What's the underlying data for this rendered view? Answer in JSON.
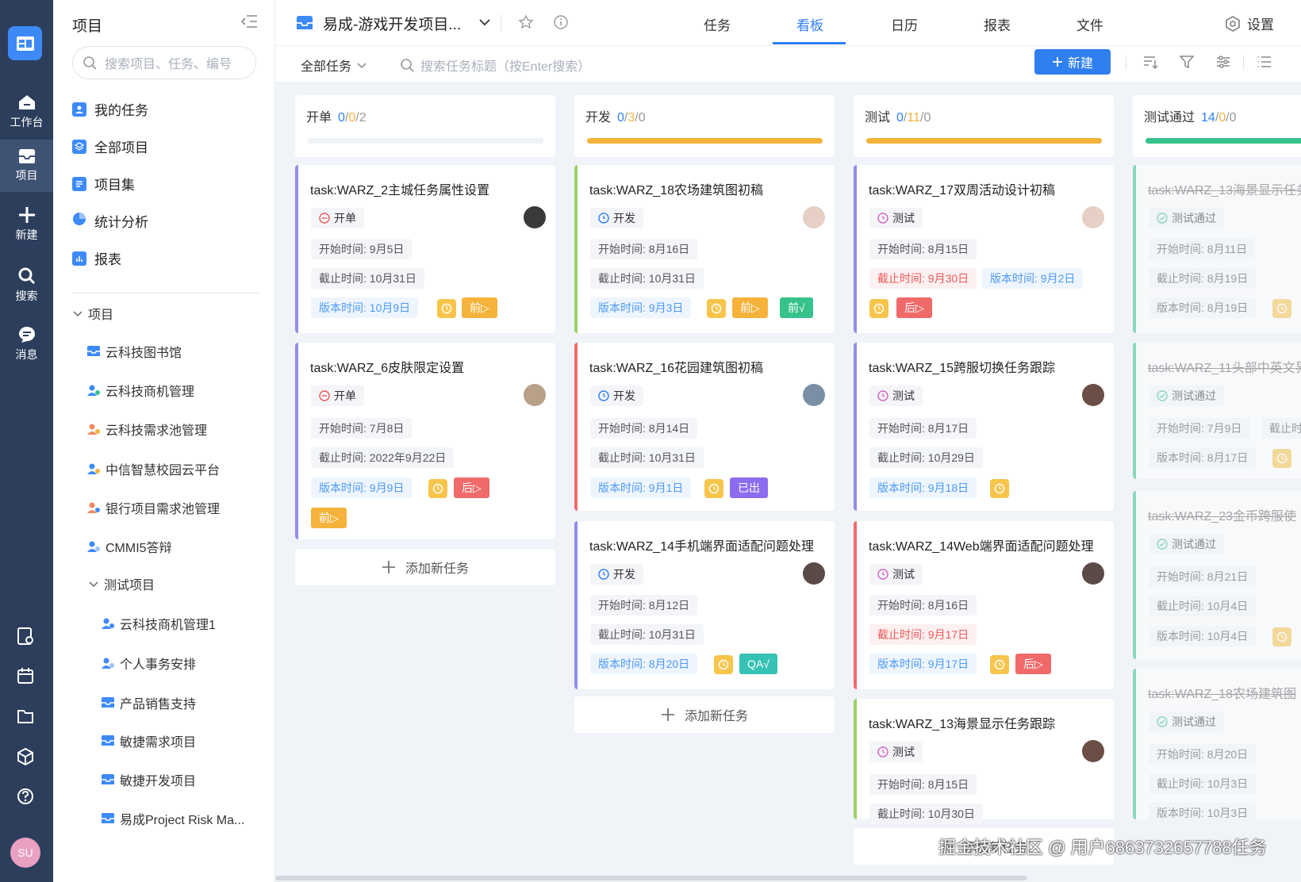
{
  "rail": {
    "items": [
      {
        "label": "工作台"
      },
      {
        "label": "项目"
      },
      {
        "label": "新建"
      },
      {
        "label": "搜索"
      },
      {
        "label": "消息"
      }
    ],
    "user_initials": "SU"
  },
  "sidebar": {
    "title": "项目",
    "search_placeholder": "搜索项目、任务、编号",
    "nav": [
      {
        "label": "我的任务"
      },
      {
        "label": "全部项目"
      },
      {
        "label": "项目集"
      },
      {
        "label": "统计分析"
      },
      {
        "label": "报表"
      }
    ],
    "group_label": "项目",
    "projects": [
      {
        "label": "云科技图书馆"
      },
      {
        "label": "云科技商机管理"
      },
      {
        "label": "云科技需求池管理"
      },
      {
        "label": "中信智慧校园云平台"
      },
      {
        "label": "银行项目需求池管理"
      },
      {
        "label": "CMMI5答辩"
      }
    ],
    "subgroup_label": "测试项目",
    "sub_projects": [
      {
        "label": "云科技商机管理1"
      },
      {
        "label": "个人事务安排"
      },
      {
        "label": "产品销售支持"
      },
      {
        "label": "敏捷需求项目"
      },
      {
        "label": "敏捷开发项目"
      },
      {
        "label": "易成Project Risk Ma..."
      }
    ]
  },
  "topbar": {
    "project_name": "易成-游戏开发项目...",
    "tabs": [
      {
        "label": "任务"
      },
      {
        "label": "看板"
      },
      {
        "label": "日历"
      },
      {
        "label": "报表"
      },
      {
        "label": "文件"
      }
    ],
    "active_tab": "看板",
    "settings_label": "设置"
  },
  "filterbar": {
    "filter_label": "全部任务",
    "search_placeholder": "搜索任务标题（按Enter搜索）",
    "new_label": "新建"
  },
  "columns": [
    {
      "name": "开单",
      "count_a": "0",
      "count_b": "0",
      "count_c": "2",
      "progress": 0,
      "bar_color": "#eef1f6"
    },
    {
      "name": "开发",
      "count_a": "0",
      "count_b": "3",
      "count_c": "0",
      "progress": 1,
      "bar_color": "#f5b33b"
    },
    {
      "name": "测试",
      "count_a": "0",
      "count_b": "11",
      "count_c": "0",
      "progress": 1,
      "bar_color": "#f5b33b"
    },
    {
      "name": "测试通过",
      "count_a": "14",
      "count_b": "0",
      "count_c": "0",
      "progress": 1,
      "bar_color": "#36c28a"
    }
  ],
  "add_task_label": "添加新任务",
  "cards": {
    "c1a": {
      "title": "task:WARZ_2主城任务属性设置",
      "status": "开单",
      "start": "开始时间: 9月5日",
      "end": "截止时间: 10月31日",
      "version": "版本时间: 10月9日",
      "pill1": "前▷"
    },
    "c1b": {
      "title": "task:WARZ_6皮肤限定设置",
      "status": "开单",
      "start": "开始时间: 7月8日",
      "end": "截止时间: 2022年9月22日",
      "version": "版本时间: 9月9日",
      "pill1": "后▷",
      "pill2": "前▷"
    },
    "c2a": {
      "title": "task:WARZ_18农场建筑图初稿",
      "status": "开发",
      "start": "开始时间: 8月16日",
      "end": "截止时间: 10月31日",
      "version": "版本时间: 9月3日",
      "pill1": "前▷",
      "pill2": "前√"
    },
    "c2b": {
      "title": "task:WARZ_16花园建筑图初稿",
      "status": "开发",
      "start": "开始时间: 8月14日",
      "end": "截止时间: 10月31日",
      "version": "版本时间: 9月1日",
      "pill1": "已出"
    },
    "c2c": {
      "title": "task:WARZ_14手机端界面适配问题处理",
      "status": "开发",
      "start": "开始时间: 8月12日",
      "end": "截止时间: 10月31日",
      "version": "版本时间: 8月20日",
      "pill1": "QA√"
    },
    "c3a": {
      "title": "task:WARZ_17双周活动设计初稿",
      "status": "测试",
      "start": "开始时间: 8月15日",
      "end": "截止时间: 9月30日",
      "version": "版本时间: 9月2日",
      "pill1": "后▷"
    },
    "c3b": {
      "title": "task:WARZ_15跨服切换任务跟踪",
      "status": "测试",
      "start": "开始时间: 8月17日",
      "end": "截止时间: 10月29日",
      "version": "版本时间: 9月18日"
    },
    "c3c": {
      "title": "task:WARZ_14Web端界面适配问题处理",
      "status": "测试",
      "start": "开始时间: 8月16日",
      "end": "截止时间: 9月17日",
      "version": "版本时间: 9月17日",
      "pill1": "后▷"
    },
    "c3d": {
      "title": "task:WARZ_13海景显示任务跟踪",
      "status": "测试",
      "start": "开始时间: 8月15日",
      "end": "截止时间: 10月30日"
    },
    "c4a": {
      "title": "task:WARZ_13海景显示任务",
      "status": "测试通过",
      "start": "开始时间: 8月11日",
      "end": "截止时间: 8月19日",
      "version": "版本时间: 8月19日"
    },
    "c4b": {
      "title": "task:WARZ_11头部中英文界",
      "status": "测试通过",
      "start": "开始时间: 7月9日",
      "end": "截止时",
      "version": "版本时间: 8月17日"
    },
    "c4c": {
      "title": "task:WARZ_23金币跨服使",
      "status": "测试通过",
      "start": "开始时间: 8月21日",
      "end": "截止时间: 10月4日",
      "version": "版本时间: 10月4日"
    },
    "c4d": {
      "title": "task:WARZ_18农场建筑图",
      "status": "测试通过",
      "start": "开始时间: 8月20日",
      "end": "截止时间: 10月3日",
      "version": "版本时间: 10月3日"
    }
  },
  "watermark": "掘金技术社区 @ 用户6863732657788任务"
}
